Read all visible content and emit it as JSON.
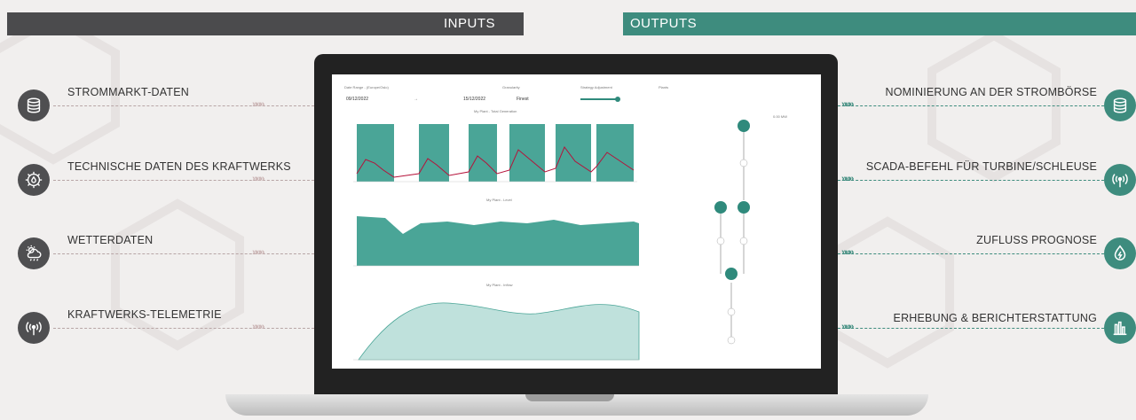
{
  "banners": {
    "inputs": "INPUTS",
    "outputs": "OUTPUTS"
  },
  "inputs": [
    {
      "label": "STROMMARKT-DATEN",
      "icon": "database-icon"
    },
    {
      "label": "TECHNISCHE DATEN DES KRAFTWERKS",
      "icon": "gear-drop-icon"
    },
    {
      "label": "WETTERDATEN",
      "icon": "weather-icon"
    },
    {
      "label": "KRAFTWERKS-TELEMETRIE",
      "icon": "antenna-icon"
    }
  ],
  "outputs": [
    {
      "label": "NOMINIERUNG AN DER STROMBÖRSE",
      "icon": "database-icon"
    },
    {
      "label": "SCADA-BEFEHL FÜR TURBINE/SCHLEUSE",
      "icon": "antenna-icon"
    },
    {
      "label": "ZUFLUSS PROGNOSE",
      "icon": "drop-icon"
    },
    {
      "label": "ERHEBUNG & BERICHTERSTATTUNG",
      "icon": "bar-chart-icon"
    }
  ],
  "chevrons": "»»»",
  "dashboard": {
    "date_range_label": "Date Range - (Europe/Oslo)",
    "date_from": "09/12/2022",
    "arrow": "→",
    "date_to": "15/12/2022",
    "granularity_label": "Granularity",
    "granularity_value": "Finest",
    "strategy_label": "Strategy Adjustment",
    "plants_label": "Plants",
    "chart1_title": "My Plant - Total Generation",
    "chart2_title": "My Plant - Level",
    "chart3_title": "My Plant - Inflow",
    "power_readout": "0.00 MW"
  },
  "colors": {
    "dark": "#4f4f51",
    "green": "#3e8c7e",
    "teal": "#2f8a7c",
    "red": "#b5123a"
  }
}
